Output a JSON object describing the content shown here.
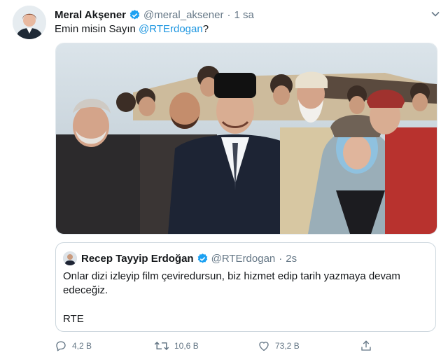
{
  "tweet": {
    "author_name": "Meral Akşener",
    "handle": "@meral_aksener",
    "separator": "·",
    "time": "1 sa",
    "text_prefix": "Emin misin Sayın ",
    "mention": "@RTErdogan",
    "text_suffix": "?"
  },
  "quote": {
    "author_name": "Recep Tayyip Erdoğan",
    "handle": "@RTErdogan",
    "separator": "·",
    "time": "2s",
    "text": "Onlar dizi izleyip film çeviredursun, biz hizmet edip tarih yazmaya devam edeceğiz.",
    "signature": "RTE"
  },
  "actions": {
    "replies": "4,2 B",
    "retweets": "10,6 B",
    "likes": "73,2 B"
  },
  "colors": {
    "accent": "#1da1f2",
    "secondary_text": "#657786",
    "border": "#ccd6dd"
  },
  "icons": [
    "verified-badge-icon",
    "chevron-down-icon",
    "reply-icon",
    "retweet-icon",
    "like-icon",
    "share-icon"
  ]
}
